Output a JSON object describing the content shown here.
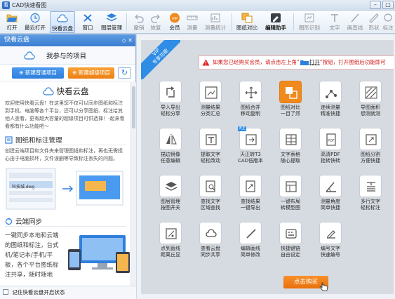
{
  "window": {
    "title": "CAD快速看图",
    "min_label": "–",
    "max_label": "□"
  },
  "toolbar": {
    "items": [
      {
        "label": "打开",
        "icon": "folder-open-icon",
        "enabled": true
      },
      {
        "label": "最近打开",
        "icon": "recent-icon",
        "enabled": true
      },
      {
        "label": "快看云盘",
        "icon": "cloud-icon",
        "enabled": true,
        "active": true
      },
      {
        "label": "窗口",
        "icon": "window-icon",
        "enabled": true
      },
      {
        "label": "图层管理",
        "icon": "layers-icon",
        "enabled": true
      },
      {
        "label": "撤销",
        "icon": "undo-icon",
        "enabled": false
      },
      {
        "label": "恢复",
        "icon": "redo-icon",
        "enabled": false
      },
      {
        "label": "会员",
        "icon": "vip-icon",
        "enabled": true
      },
      {
        "label": "测量",
        "icon": "measure-icon",
        "enabled": false
      },
      {
        "label": "测量统计",
        "icon": "measure-stats-icon",
        "enabled": false
      },
      {
        "label": "图纸对比",
        "icon": "compare-icon",
        "enabled": true
      },
      {
        "label": "编辑助手",
        "icon": "edit-assistant-icon",
        "enabled": true
      },
      {
        "label": "图形识别",
        "icon": "recognize-icon",
        "enabled": false
      },
      {
        "label": "文字",
        "icon": "text-icon",
        "enabled": false
      },
      {
        "label": "画直线",
        "icon": "line-icon",
        "enabled": false
      },
      {
        "label": "形状",
        "icon": "shape-icon",
        "enabled": false
      },
      {
        "label": "标注",
        "icon": "annotate-icon",
        "enabled": false
      }
    ]
  },
  "panel": {
    "title": "快看云盘",
    "header_buttons": "◇ ✕",
    "subtitle": "我参与的项目",
    "new_normal": "⊕ 新建普通项目",
    "new_super": "⊕ 新建超级项目",
    "refresh": "↻",
    "section_title": "快看云盘",
    "intro": "欢迎使用快看云盘！在这里您不仅可以同步图纸和标注到手机、电脑等各个平台，还可以分享图纸、标注给其他人查看，更有超大容量的超级项目可供选择！-起来看看都有什么功能吧～",
    "sub1_title": "图纸和标注管理",
    "sub1_text": "创建云端项目和文件夹来管理图纸和标注，再也无需担心由于电脑损坏，文件误删等导致标注丢失的问题。",
    "illus_file_label": "科技城.dwg",
    "sub2_title": "云端同步",
    "sub2_text": "一键同步本地和云端的图纸和标注，台式机/笔记本/手机/平板，各个平台图纸标注共享，随时随地",
    "footer": "记住快看云盘开启状态"
  },
  "main": {
    "ribbon": "VIP\n专享功能",
    "notice_pre": "如果您已经购买会员，请点击左上角“",
    "notice_open": "打开",
    "notice_post": "”按钮，打开图纸后功能即可",
    "features": [
      {
        "name": "导入导出\n轻松分享",
        "icon": "import-export-icon"
      },
      {
        "name": "测量结果\n分类汇总",
        "icon": "measure-summary-icon"
      },
      {
        "name": "图纸合并\n移动复制",
        "icon": "merge-move-icon"
      },
      {
        "name": "图纸对比\n一目了然",
        "icon": "compare-icon",
        "orange": true
      },
      {
        "name": "连续测量\n精准快捷",
        "icon": "continuous-measure-icon"
      },
      {
        "name": "导图面积\n想测就测",
        "icon": "area-measure-icon"
      },
      {
        "name": "描边镜像\n任意编辑",
        "icon": "mirror-icon"
      },
      {
        "name": "提取文字\n轻松改动",
        "icon": "extract-text-icon"
      },
      {
        "name": "天正转T3\nCAD低版本",
        "icon": "convert-t3-icon",
        "tag": "天正"
      },
      {
        "name": "文字表格\n随心提取",
        "icon": "text-table-icon"
      },
      {
        "name": "高清PDF\n批转快转",
        "icon": "pdf-icon"
      },
      {
        "name": "图纸分割\n方便快捷",
        "icon": "split-icon"
      },
      {
        "name": "图层管理\n按图开关",
        "icon": "layer-manage-icon"
      },
      {
        "name": "查找文字\n区域查找",
        "icon": "find-text-icon"
      },
      {
        "name": "查找结果\n一键导出",
        "icon": "export-result-icon"
      },
      {
        "name": "一键布局\n转模型图",
        "icon": "layout-icon"
      },
      {
        "name": "测量角度\n简单快捷",
        "icon": "angle-icon"
      },
      {
        "name": "多行文字\n轻松标注",
        "icon": "multiline-text-icon"
      },
      {
        "name": "点到直线\n距离丘显",
        "icon": "point-line-icon"
      },
      {
        "name": "查看云盘\n同步共享",
        "icon": "cloud-sync-icon"
      },
      {
        "name": "编辑画线\n简单修改",
        "icon": "draw-line-icon"
      },
      {
        "name": "快捷键链\n自由设定",
        "icon": "shortcut-icon"
      },
      {
        "name": "编号文字\n快速编号",
        "icon": "numbering-icon"
      }
    ],
    "buy_button": "点击购买"
  },
  "colors": {
    "accent": "#2f7fdc",
    "orange": "#ec7f12",
    "warning_red": "#d01818"
  }
}
